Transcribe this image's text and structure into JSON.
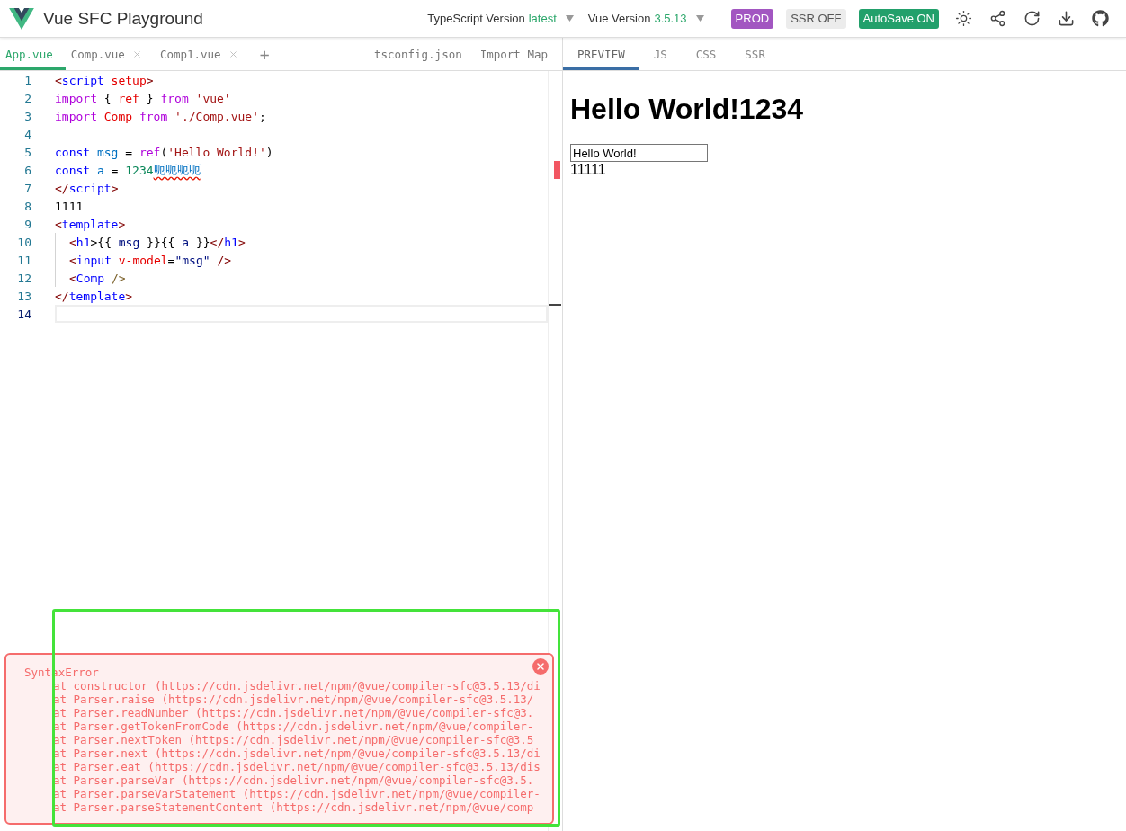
{
  "header": {
    "title": "Vue SFC Playground",
    "ts_version": {
      "label": "TypeScript Version",
      "value": "latest"
    },
    "vue_version": {
      "label": "Vue Version",
      "value": "3.5.13"
    },
    "toggles": [
      {
        "label": "PROD",
        "kind": "prod"
      },
      {
        "label": "SSR OFF",
        "kind": "off"
      },
      {
        "label": "AutoSave ON",
        "kind": "on"
      }
    ]
  },
  "file_tabs": [
    {
      "label": "App.vue",
      "selected": true,
      "closable": false
    },
    {
      "label": "Comp.vue",
      "selected": false,
      "closable": true
    },
    {
      "label": "Comp1.vue",
      "selected": false,
      "closable": true
    }
  ],
  "add_tab": "+",
  "extra_tabs": [
    "tsconfig.json",
    "Import Map"
  ],
  "editor": {
    "lines": [
      {
        "number": "1",
        "tokens": [
          {
            "t": "<",
            "kind": "bracket"
          },
          {
            "t": "script",
            "kind": "tag"
          },
          {
            "t": " setup",
            "kind": "attr"
          },
          {
            "t": ">",
            "kind": "bracket"
          }
        ]
      },
      {
        "number": "2",
        "tokens": [
          {
            "t": "import",
            "kind": "keyword"
          },
          {
            "t": " { ",
            "kind": "text"
          },
          {
            "t": "ref",
            "kind": "attr"
          },
          {
            "t": " } ",
            "kind": "text"
          },
          {
            "t": "from",
            "kind": "keyword"
          },
          {
            "t": " 'vue'",
            "kind": "string"
          }
        ]
      },
      {
        "number": "3",
        "tokens": [
          {
            "t": "import",
            "kind": "keyword"
          },
          {
            "t": " Comp ",
            "kind": "attr"
          },
          {
            "t": "from",
            "kind": "keyword"
          },
          {
            "t": " './Comp.vue'",
            "kind": "string"
          },
          {
            "t": ";",
            "kind": "text"
          }
        ]
      },
      {
        "number": "4"
      },
      {
        "number": "5",
        "tokens": [
          {
            "t": "const",
            "kind": "decl"
          },
          {
            "t": " msg",
            "kind": "var"
          },
          {
            "t": " = ",
            "kind": "text"
          },
          {
            "t": "ref",
            "kind": "keyword"
          },
          {
            "t": "(",
            "kind": "text"
          },
          {
            "t": "'Hello World!'",
            "kind": "string"
          },
          {
            "t": ")",
            "kind": "text"
          }
        ]
      },
      {
        "number": "6",
        "tokens": [
          {
            "t": "const",
            "kind": "decl"
          },
          {
            "t": " a",
            "kind": "var"
          },
          {
            "t": " = ",
            "kind": "text"
          },
          {
            "t": "1234",
            "kind": "number"
          },
          {
            "t": "呃呃呃呃",
            "kind": "error"
          }
        ]
      },
      {
        "number": "7",
        "tokens": [
          {
            "t": "</",
            "kind": "bracket"
          },
          {
            "t": "script",
            "kind": "tag"
          },
          {
            "t": ">",
            "kind": "bracket"
          }
        ]
      },
      {
        "number": "8",
        "tokens": [
          {
            "t": "1111",
            "kind": "text"
          }
        ]
      },
      {
        "number": "9",
        "tokens": [
          {
            "t": "<",
            "kind": "bracket"
          },
          {
            "t": "template",
            "kind": "tag"
          },
          {
            "t": ">",
            "kind": "bracket"
          }
        ]
      },
      {
        "number": "10",
        "guide": true,
        "tokens": [
          {
            "t": "<",
            "kind": "bracket"
          },
          {
            "t": "h1",
            "kind": "tag"
          },
          {
            "t": ">{{ ",
            "kind": "text"
          },
          {
            "t": "msg",
            "kind": "mustache"
          },
          {
            "t": " }}{{ ",
            "kind": "text"
          },
          {
            "t": "a",
            "kind": "mustache"
          },
          {
            "t": " }}",
            "kind": "text"
          },
          {
            "t": "</",
            "kind": "bracket"
          },
          {
            "t": "h1",
            "kind": "tag"
          },
          {
            "t": ">",
            "kind": "bracket"
          }
        ]
      },
      {
        "number": "11",
        "guide": true,
        "tokens": [
          {
            "t": "<",
            "kind": "bracket"
          },
          {
            "t": "input",
            "kind": "tag"
          },
          {
            "t": " v-model",
            "kind": "attr"
          },
          {
            "t": "=",
            "kind": "text"
          },
          {
            "t": "\"msg\"",
            "kind": "mustache"
          },
          {
            "t": " />",
            "kind": "bracket"
          }
        ]
      },
      {
        "number": "12",
        "guide": true,
        "tokens": [
          {
            "t": "<",
            "kind": "bracket"
          },
          {
            "t": "Comp",
            "kind": "tag"
          },
          {
            "t": " />",
            "kind": "comp"
          }
        ]
      },
      {
        "number": "13",
        "tokens": [
          {
            "t": "</",
            "kind": "bracket"
          },
          {
            "t": "template",
            "kind": "tag"
          },
          {
            "t": ">",
            "kind": "bracket"
          }
        ]
      },
      {
        "number": "14",
        "current": true
      }
    ]
  },
  "error": {
    "title": "SyntaxError",
    "stack": [
      "at constructor (https://cdn.jsdelivr.net/npm/@vue/compiler-sfc@3.5.13/di",
      "at Parser.raise (https://cdn.jsdelivr.net/npm/@vue/compiler-sfc@3.5.13/",
      "at Parser.readNumber (https://cdn.jsdelivr.net/npm/@vue/compiler-sfc@3.",
      "at Parser.getTokenFromCode (https://cdn.jsdelivr.net/npm/@vue/compiler-",
      "at Parser.nextToken (https://cdn.jsdelivr.net/npm/@vue/compiler-sfc@3.5",
      "at Parser.next (https://cdn.jsdelivr.net/npm/@vue/compiler-sfc@3.5.13/di",
      "at Parser.eat (https://cdn.jsdelivr.net/npm/@vue/compiler-sfc@3.5.13/dis",
      "at Parser.parseVar (https://cdn.jsdelivr.net/npm/@vue/compiler-sfc@3.5.",
      "at Parser.parseVarStatement (https://cdn.jsdelivr.net/npm/@vue/compiler-",
      "at Parser.parseStatementContent (https://cdn.jsdelivr.net/npm/@vue/comp"
    ]
  },
  "output_tabs": [
    {
      "label": "PREVIEW",
      "selected": true
    },
    {
      "label": "JS",
      "selected": false
    },
    {
      "label": "CSS",
      "selected": false
    },
    {
      "label": "SSR",
      "selected": false
    }
  ],
  "preview": {
    "heading": "Hello World!1234",
    "input_value": "Hello World!",
    "text": "11111"
  }
}
